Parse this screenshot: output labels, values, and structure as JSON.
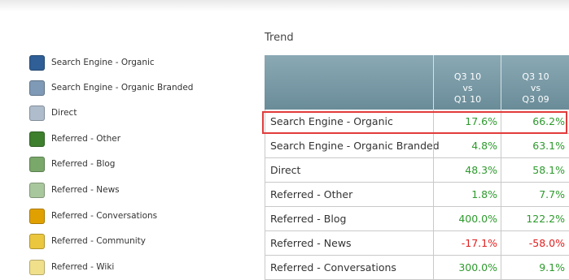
{
  "trend_title": "Trend",
  "legend": [
    {
      "label": "Search Engine - Organic",
      "color": "#2f5f96"
    },
    {
      "label": "Search Engine - Organic Branded",
      "color": "#7f9ab6"
    },
    {
      "label": "Direct",
      "color": "#aebccc"
    },
    {
      "label": "Referred - Other",
      "color": "#3e7f2e"
    },
    {
      "label": "Referred - Blog",
      "color": "#79a86a"
    },
    {
      "label": "Referred - News",
      "color": "#a9c79c"
    },
    {
      "label": "Referred - Conversations",
      "color": "#e0a100"
    },
    {
      "label": "Referred - Community",
      "color": "#ebc63f"
    },
    {
      "label": "Referred - Wiki",
      "color": "#f0e08c"
    }
  ],
  "table": {
    "headers": {
      "col1": [
        "Q3 10",
        "vs",
        "Q1 10"
      ],
      "col2": [
        "Q3 10",
        "vs",
        "Q3 09"
      ]
    },
    "rows": [
      {
        "name": "Search Engine - Organic",
        "v1": "17.6%",
        "v1_sign": "pos",
        "v2": "66.2%",
        "v2_sign": "pos"
      },
      {
        "name": "Search Engine - Organic Branded",
        "v1": "4.8%",
        "v1_sign": "pos",
        "v2": "63.1%",
        "v2_sign": "pos"
      },
      {
        "name": "Direct",
        "v1": "48.3%",
        "v1_sign": "pos",
        "v2": "58.1%",
        "v2_sign": "pos"
      },
      {
        "name": "Referred - Other",
        "v1": "1.8%",
        "v1_sign": "pos",
        "v2": "7.7%",
        "v2_sign": "pos"
      },
      {
        "name": "Referred - Blog",
        "v1": "400.0%",
        "v1_sign": "pos",
        "v2": "122.2%",
        "v2_sign": "pos"
      },
      {
        "name": "Referred - News",
        "v1": "-17.1%",
        "v1_sign": "neg",
        "v2": "-58.0%",
        "v2_sign": "neg"
      },
      {
        "name": "Referred - Conversations",
        "v1": "300.0%",
        "v1_sign": "pos",
        "v2": "9.1%",
        "v2_sign": "pos"
      }
    ]
  },
  "colors": {
    "highlight": "#e23b3b",
    "positive": "#2d9a2d",
    "negative": "#e02020",
    "header": "#7396a3"
  }
}
